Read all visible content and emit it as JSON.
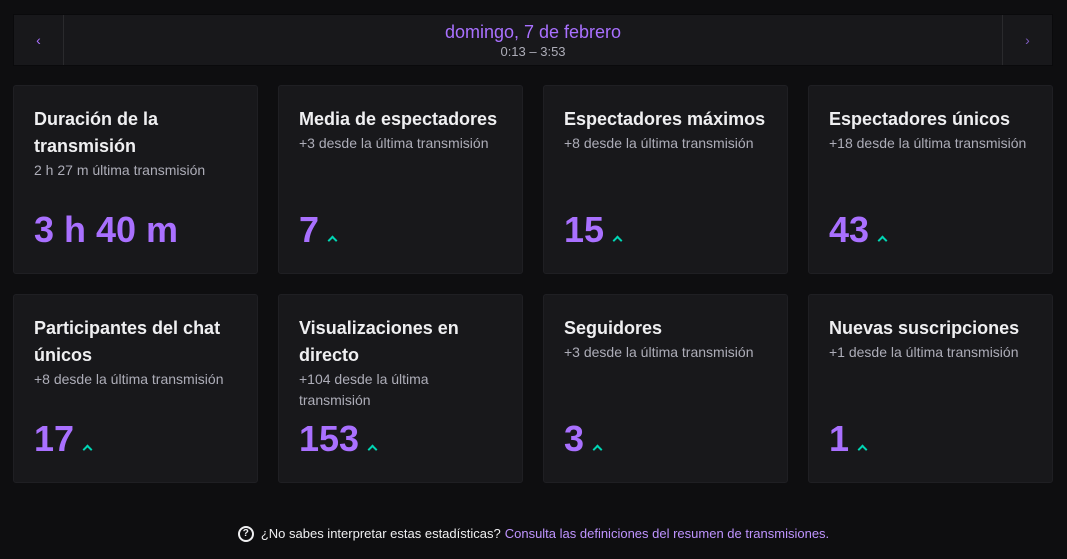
{
  "header": {
    "prev_icon": "‹",
    "next_icon": "›",
    "date": "domingo, 7 de febrero",
    "time_range": "0:13 – 3:53"
  },
  "cards": [
    {
      "title": "Duración de la transmisión",
      "sub": "2 h 27 m última transmisión",
      "value": "3 h 40 m",
      "trend": "none"
    },
    {
      "title": "Media de espectadores",
      "sub": "+3 desde la última transmisión",
      "value": "7",
      "trend": "up"
    },
    {
      "title": "Espectadores máximos",
      "sub": "+8 desde la última transmisión",
      "value": "15",
      "trend": "up"
    },
    {
      "title": "Espectadores únicos",
      "sub": "+18 desde la última transmisión",
      "value": "43",
      "trend": "up"
    },
    {
      "title": "Participantes del chat únicos",
      "sub": "+8 desde la última transmisión",
      "value": "17",
      "trend": "up"
    },
    {
      "title": "Visualizaciones en directo",
      "sub": "+104 desde la última transmisión",
      "value": "153",
      "trend": "up"
    },
    {
      "title": "Seguidores",
      "sub": "+3 desde la última transmisión",
      "value": "3",
      "trend": "up"
    },
    {
      "title": "Nuevas suscripciones",
      "sub": "+1 desde la última transmisión",
      "value": "1",
      "trend": "up"
    }
  ],
  "footer": {
    "help_icon": "?",
    "question": "¿No sabes interpretar estas estadísticas?",
    "link": "Consulta las definiciones del resumen de transmisiones."
  },
  "colors": {
    "accent": "#a970ff",
    "trend_up": "#00d6b4",
    "card_bg": "#18181b",
    "page_bg": "#0e0e10"
  }
}
